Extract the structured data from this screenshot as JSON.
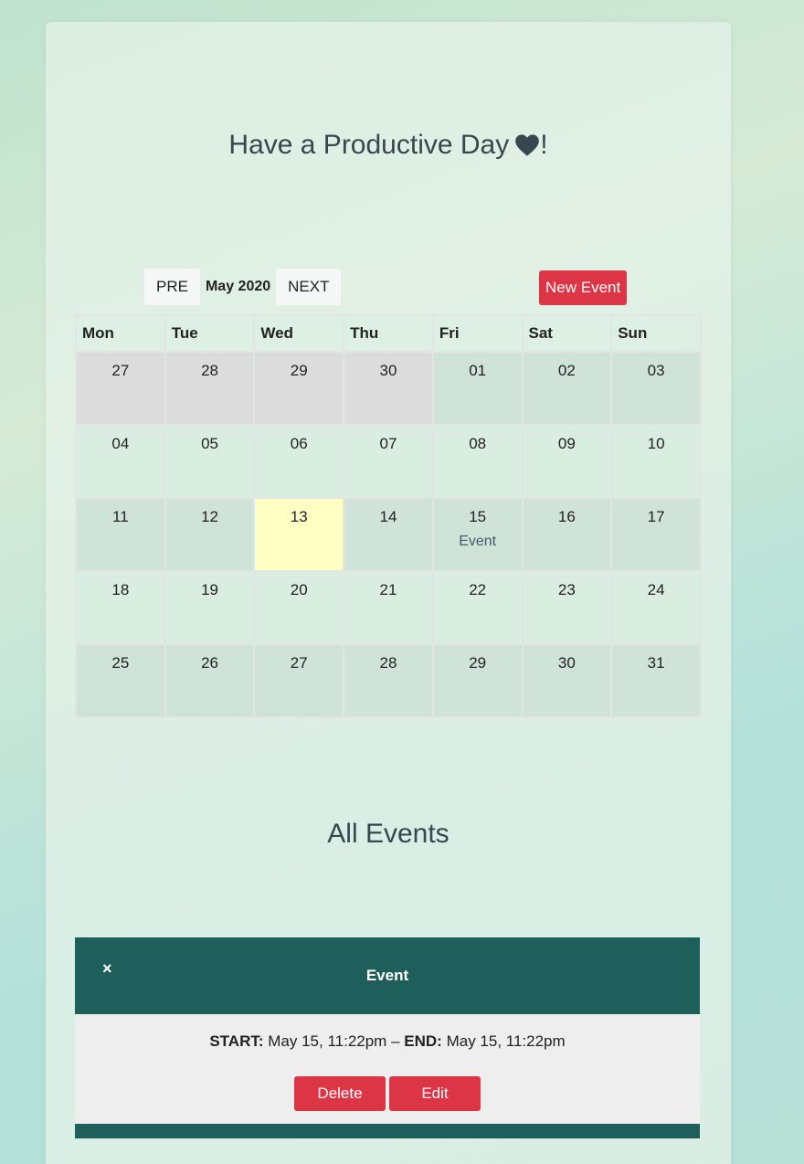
{
  "header": {
    "greeting": "Have a Productive Day",
    "greeting_suffix": "!",
    "icon": "heart-icon"
  },
  "toolbar": {
    "prev_label": "PRE",
    "month": "May 2020",
    "next_label": "NEXT",
    "new_event_label": "New Event"
  },
  "calendar": {
    "weekdays": [
      "Mon",
      "Tue",
      "Wed",
      "Thu",
      "Fri",
      "Sat",
      "Sun"
    ],
    "weeks": [
      [
        "27",
        "28",
        "29",
        "30",
        "01",
        "02",
        "03"
      ],
      [
        "04",
        "05",
        "06",
        "07",
        "08",
        "09",
        "10"
      ],
      [
        "11",
        "12",
        "13",
        "14",
        "15",
        "16",
        "17"
      ],
      [
        "18",
        "19",
        "20",
        "21",
        "22",
        "23",
        "24"
      ],
      [
        "25",
        "26",
        "27",
        "28",
        "29",
        "30",
        "31"
      ]
    ],
    "event_on_15": "Event"
  },
  "events_section": {
    "title": "All Events"
  },
  "event_panel": {
    "close_glyph": "×",
    "title": "Event",
    "start_label": "START:",
    "start_value": "May 15, 11:22pm",
    "separator": "–",
    "end_label": "END:",
    "end_value": "May 15, 11:22pm",
    "delete_label": "Delete",
    "edit_label": "Edit"
  },
  "colors": {
    "accent_red": "#dc3545",
    "panel_teal": "#1f5f5b",
    "today_highlight": "#ffffc4"
  }
}
